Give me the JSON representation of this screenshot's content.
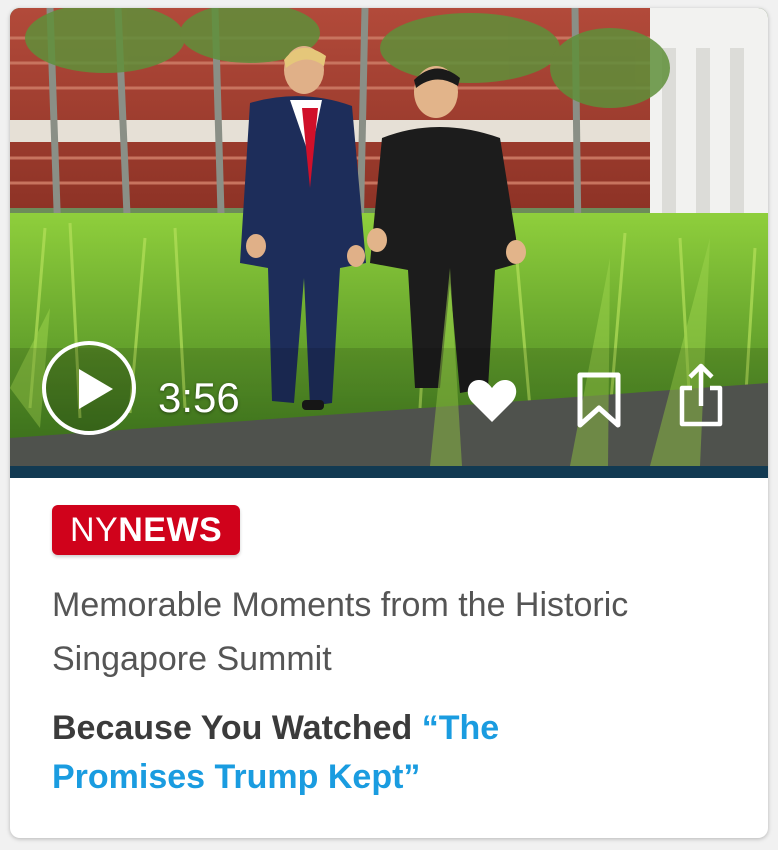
{
  "video": {
    "duration": "3:56",
    "thumbnail_alt": "Two men walking along a garden path"
  },
  "actions": {
    "play_icon": "play-icon",
    "like_icon": "heart-icon",
    "save_icon": "bookmark-icon",
    "share_icon": "share-icon"
  },
  "brand": {
    "prefix": "NY",
    "suffix": "NEWS",
    "color": "#d0021b"
  },
  "article": {
    "headline": "Memorable Moments from the Historic Singapore Summit"
  },
  "recommendation": {
    "lead": "Because You Watched ",
    "title": "“The Promises Trump Kept”",
    "title_color": "#1a9ce0"
  }
}
